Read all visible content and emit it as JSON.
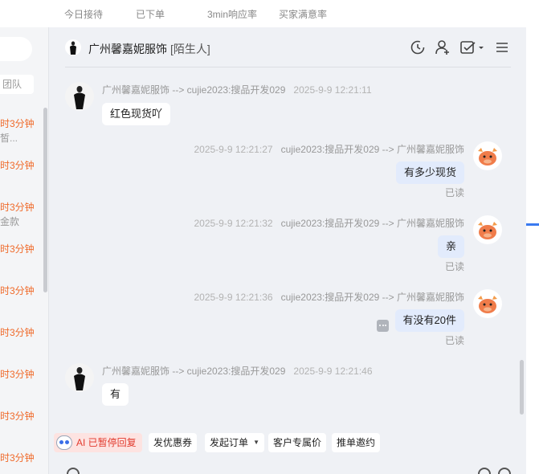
{
  "stats": {
    "today_received": "今日接待",
    "ordered": "已下单",
    "response_rate": "3min响应率",
    "satisfaction": "买家满意率"
  },
  "left": {
    "team": "团队",
    "items": [
      "时3分钟",
      "时3分钟",
      "时3分钟",
      "时3分钟",
      "时3分钟",
      "时3分钟",
      "时3分钟",
      "时3分钟",
      "时3分钟",
      "时3分钟"
    ],
    "subs": [
      "皙...",
      "金款"
    ]
  },
  "chat": {
    "title": "广州馨嘉妮服饰",
    "tag": "[陌生人]",
    "icons": [
      "refresh-icon",
      "user-add-icon",
      "order-check-icon",
      "menu-icon"
    ],
    "messages": [
      {
        "side": "left",
        "meta": "广州馨嘉妮服饰 --> cujie2023:搜品开发029",
        "time": "2025-9-9 12:21:11",
        "text": "红色现货吖"
      },
      {
        "side": "right",
        "meta": "cujie2023:搜品开发029 --> 广州馨嘉妮服饰",
        "time": "2025-9-9 12:21:27",
        "text": "有多少现货",
        "status": "已读"
      },
      {
        "side": "right",
        "meta": "cujie2023:搜品开发029 --> 广州馨嘉妮服饰",
        "time": "2025-9-9 12:21:32",
        "text": "亲",
        "status": "已读"
      },
      {
        "side": "right",
        "meta": "cujie2023:搜品开发029 --> 广州馨嘉妮服饰",
        "time": "2025-9-9 12:21:36",
        "text": "有没有20件",
        "status": "已读"
      },
      {
        "side": "left",
        "meta": "广州馨嘉妮服饰 --> cujie2023:搜品开发029",
        "time": "2025-9-9 12:21:46",
        "text": "有"
      }
    ],
    "quick": {
      "ai": "AI 已暂停回复",
      "coupon": "发优惠券",
      "order": "发起订单",
      "price": "客户专属价",
      "invite": "推单邀约"
    }
  },
  "colors": {
    "accent_orange": "#f06a2a",
    "bubble_right": "#e2ebfc",
    "ai_red": "#e23b2e"
  }
}
